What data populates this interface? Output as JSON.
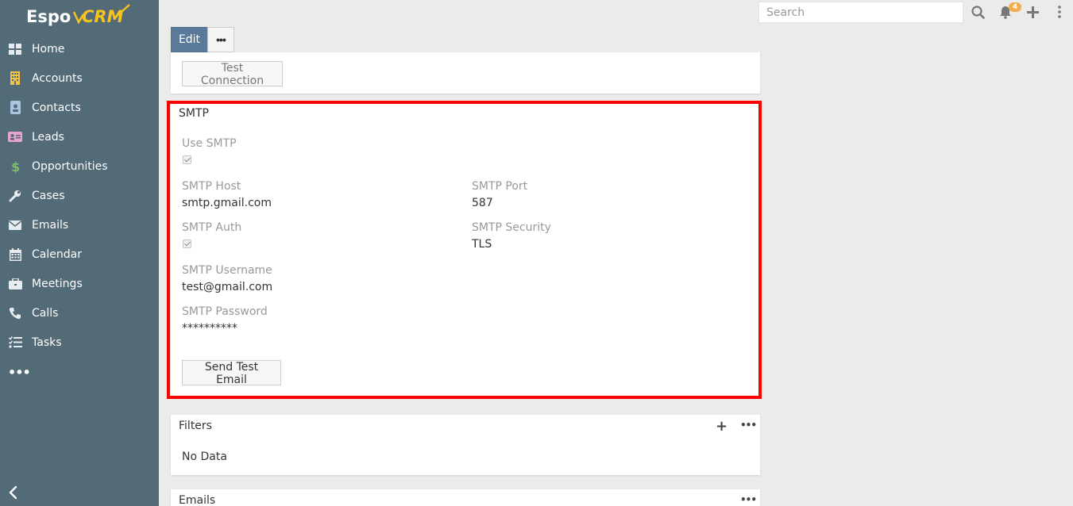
{
  "app": {
    "logo_text": "EspoCRM"
  },
  "sidebar": {
    "items": [
      {
        "label": "Home",
        "icon": "grid-icon"
      },
      {
        "label": "Accounts",
        "icon": "building-icon"
      },
      {
        "label": "Contacts",
        "icon": "id-badge-icon"
      },
      {
        "label": "Leads",
        "icon": "address-card-icon"
      },
      {
        "label": "Opportunities",
        "icon": "dollar-icon"
      },
      {
        "label": "Cases",
        "icon": "wrench-icon"
      },
      {
        "label": "Emails",
        "icon": "envelope-icon"
      },
      {
        "label": "Calendar",
        "icon": "calendar-icon"
      },
      {
        "label": "Meetings",
        "icon": "briefcase-icon"
      },
      {
        "label": "Calls",
        "icon": "phone-icon"
      },
      {
        "label": "Tasks",
        "icon": "tasks-icon"
      }
    ],
    "more_label": "•••"
  },
  "topbar": {
    "search_placeholder": "Search",
    "notification_count": "4"
  },
  "actions": {
    "edit_label": "Edit",
    "more_label": "•••"
  },
  "connection": {
    "test_button_label": "Test Connection"
  },
  "smtp": {
    "title": "SMTP",
    "use_smtp_label": "Use SMTP",
    "use_smtp_checked": true,
    "host_label": "SMTP Host",
    "host_value": "smtp.gmail.com",
    "port_label": "SMTP Port",
    "port_value": "587",
    "auth_label": "SMTP Auth",
    "auth_checked": true,
    "security_label": "SMTP Security",
    "security_value": "TLS",
    "username_label": "SMTP Username",
    "username_value": "test@gmail.com",
    "password_label": "SMTP Password",
    "password_value": "**********",
    "send_test_label": "Send Test Email"
  },
  "filters": {
    "title": "Filters",
    "add_label": "+",
    "more_label": "•••",
    "empty_text": "No Data"
  },
  "emails_panel": {
    "title": "Emails",
    "more_label": "•••"
  },
  "colors": {
    "sidebar_bg": "#536a77",
    "edit_button_bg": "#5a7a99",
    "highlight": "#ff0000",
    "badge": "#f0ad4e",
    "logo_accent": "#f7c31f"
  }
}
